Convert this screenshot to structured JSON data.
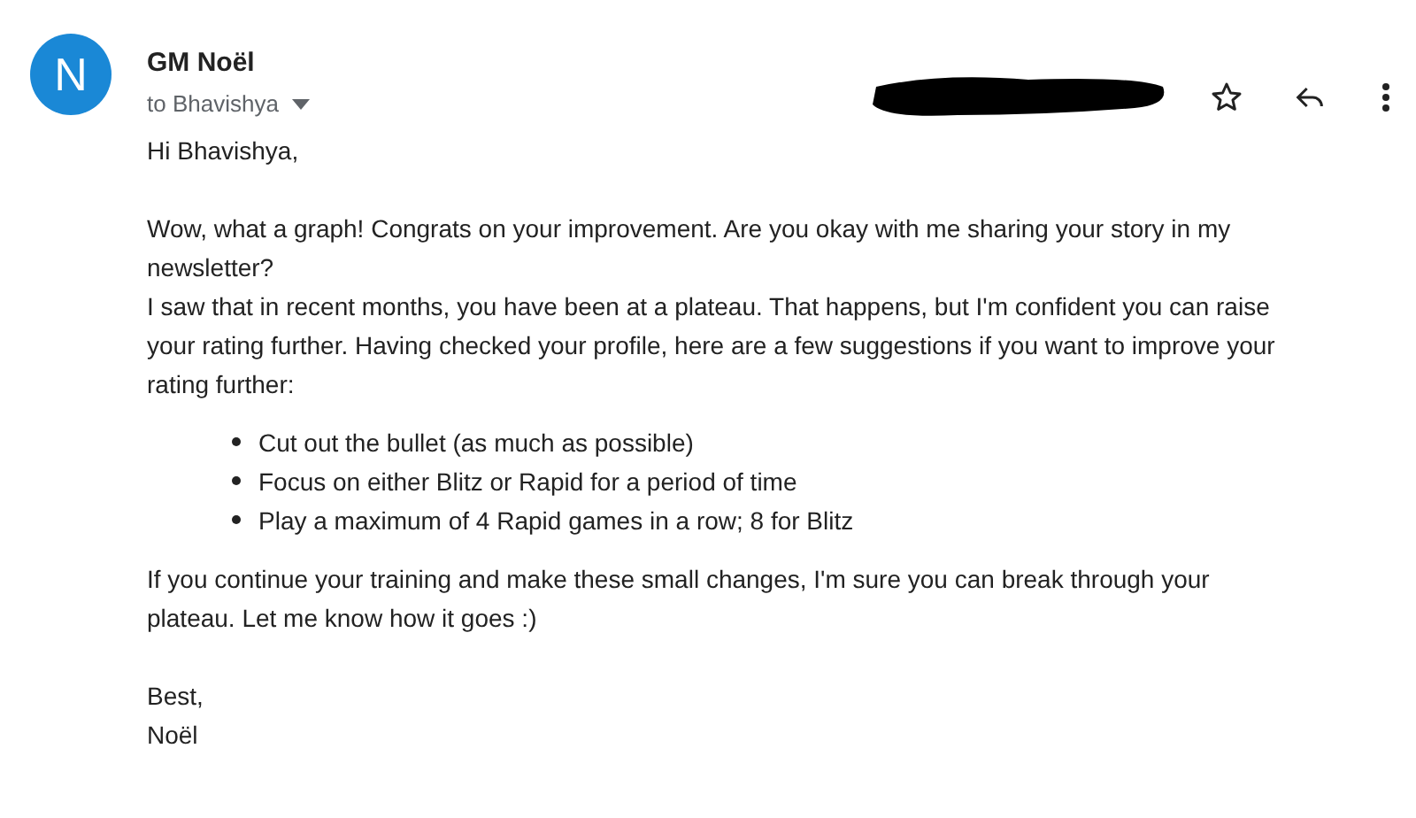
{
  "sender": {
    "initial": "N",
    "name": "GM Noël",
    "recipient": "to Bhavishya"
  },
  "body": {
    "greeting": "Hi Bhavishya,",
    "paragraphs": [
      "Wow, what a graph! Congrats on your improvement. Are you okay with me sharing your story in my newsletter?",
      "I saw that in recent months, you have been at a plateau. That happens, but I'm confident you can raise your rating further. Having checked your profile, here are a few suggestions if you want to improve your rating further:"
    ],
    "bullets": [
      "Cut out the bullet (as much as possible)",
      "Focus on either Blitz or Rapid for a period of time",
      "Play a maximum of 4 Rapid games in a row; 8 for Blitz"
    ],
    "closing": "If you continue your training and make these small changes, I'm sure you can break through your plateau. Let me know how it goes :)",
    "signoff": [
      "Best,",
      "Noël"
    ]
  }
}
